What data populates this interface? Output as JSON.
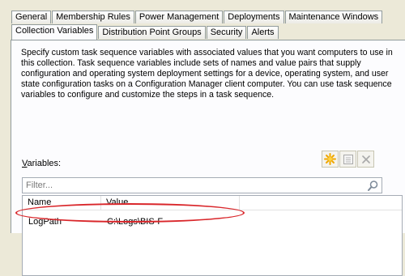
{
  "tabs_row1": [
    "General",
    "Membership Rules",
    "Power Management",
    "Deployments",
    "Maintenance Windows"
  ],
  "tabs_row2": [
    "Collection Variables",
    "Distribution Point Groups",
    "Security",
    "Alerts"
  ],
  "active_tab": "Collection Variables",
  "description": "Specify custom task sequence variables with associated values that you want computers to use in this collection. Task sequence variables include sets of names and value pairs that supply configuration and operating system deployment settings for a device, operating system, and user state configuration tasks on a Configuration Manager client computer. You can use task sequence variables to configure and customize the steps in a task sequence.",
  "variables_label": "Variables:",
  "filter_placeholder": "Filter...",
  "columns": [
    "Name",
    "Value"
  ],
  "rows": [
    {
      "name": "LogPath",
      "value": "C:\\Logs\\BIS-F"
    }
  ],
  "toolbar": {
    "new_icon": "new-star-icon",
    "properties_icon": "properties-icon",
    "delete_icon": "delete-x-icon"
  },
  "colors": {
    "highlight": "#d9262a",
    "tab_border": "#919b9c",
    "dialog_bg": "#ece9d8"
  }
}
